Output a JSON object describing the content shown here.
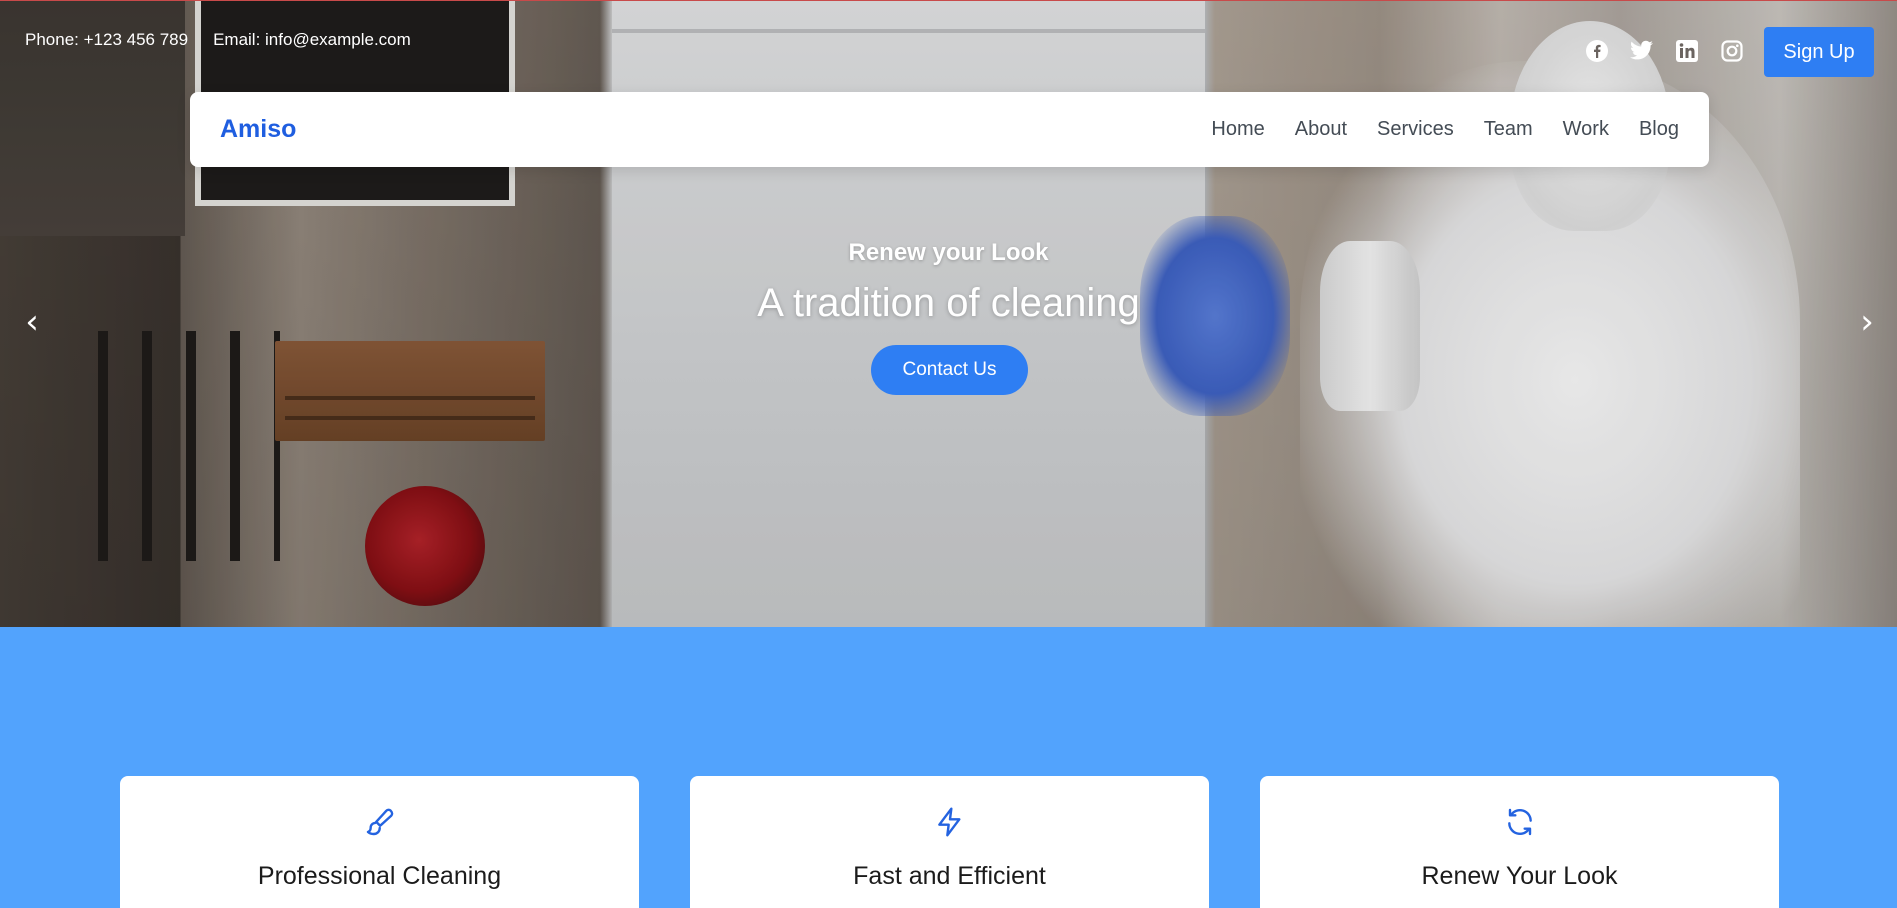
{
  "topbar": {
    "phone": "Phone: +123 456 789",
    "email": "Email: info@example.com",
    "social": [
      "facebook-icon",
      "twitter-icon",
      "linkedin-icon",
      "instagram-icon"
    ],
    "signup_label": "Sign Up"
  },
  "navbar": {
    "brand": "Amiso",
    "links": [
      "Home",
      "About",
      "Services",
      "Team",
      "Work",
      "Blog"
    ]
  },
  "hero": {
    "subtitle": "Renew your Look",
    "title": "A tradition of cleaning",
    "cta_label": "Contact Us",
    "prev_arrow": "‹",
    "next_arrow": "›"
  },
  "features": [
    {
      "icon": "brush-icon",
      "title": "Professional Cleaning"
    },
    {
      "icon": "lightning-icon",
      "title": "Fast and Efficient"
    },
    {
      "icon": "refresh-icon",
      "title": "Renew Your Look"
    }
  ],
  "colors": {
    "accent": "#2e7ef3",
    "brand": "#1f5ee0",
    "section_bg": "#52a3fd",
    "navbar_bg": "#ffffff"
  }
}
